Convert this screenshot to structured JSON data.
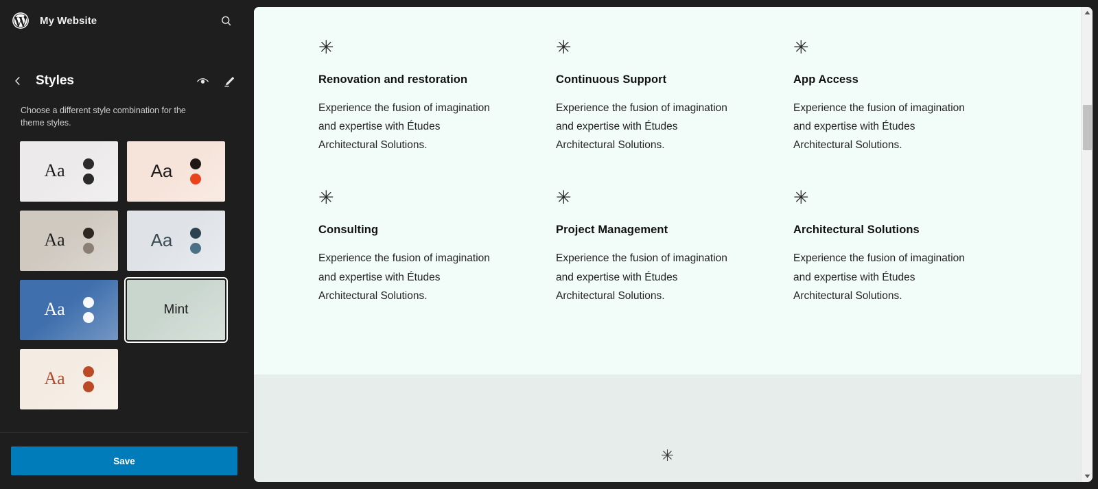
{
  "app": {
    "site_title": "My Website",
    "logo_icon": "wordpress-logo-icon",
    "search_icon": "search-icon"
  },
  "styles_panel": {
    "back_icon": "chevron-left-icon",
    "title": "Styles",
    "preview_icon": "eye-icon",
    "edit_icon": "pencil-icon",
    "description": "Choose a different style combination for the theme styles.",
    "save_label": "Save",
    "save_color": "#007cba",
    "variations": [
      {
        "name": "variation-1",
        "sample_text": "Aa",
        "font": "serif",
        "background": "#eceaea",
        "text_color": "#1d1d1d",
        "dot_1": "#2b2b2b",
        "dot_2": "#2b2b2b",
        "selected": false
      },
      {
        "name": "variation-2",
        "sample_text": "Aa",
        "font": "sans",
        "background": "#f6e3d9",
        "text_color": "#1d1d1d",
        "dot_1": "#211714",
        "dot_2": "#e8431a",
        "selected": false
      },
      {
        "name": "variation-3",
        "sample_text": "Aa",
        "font": "serif",
        "background": "#cfc9c0",
        "text_color": "#1d1d1d",
        "dot_1": "#2d2722",
        "dot_2": "#8b7f75",
        "selected": false
      },
      {
        "name": "variation-4",
        "sample_text": "Aa",
        "font": "sans",
        "background": "#dfe3e8",
        "text_color": "#3b4b54",
        "dot_1": "#2c4250",
        "dot_2": "#4a7186",
        "selected": false
      },
      {
        "name": "variation-5",
        "sample_text": "Aa",
        "font": "serif",
        "background": "#3f6fad",
        "text_color": "#ffffff",
        "dot_1": "#f7f9fc",
        "dot_2": "#f7f9fc",
        "selected": false
      },
      {
        "name": "variation-mint",
        "sample_text": "Mint",
        "font": "sans",
        "background": "#c9d6ce",
        "text_color": "#1d1d1d",
        "dot_1": null,
        "dot_2": null,
        "selected": true
      },
      {
        "name": "variation-7",
        "sample_text": "Aa",
        "font": "serif",
        "background": "#f4ece2",
        "text_color": "#b8492a",
        "dot_1": "#bb4a27",
        "dot_2": "#bb4a27",
        "selected": false
      }
    ]
  },
  "canvas": {
    "background": "#f2fcf8",
    "footer_background": "#e6edea",
    "asterisk_glyph": "✳",
    "footer_asterisk_glyph": "✳",
    "body_text": "Experience the fusion of imagination and expertise with Études Architectural Solutions.",
    "features": [
      {
        "title": "Renovation and restoration",
        "text": "Experience the fusion of imagination and expertise with Études Architectural Solutions."
      },
      {
        "title": "Continuous Support",
        "text": "Experience the fusion of imagination and expertise with Études Architectural Solutions."
      },
      {
        "title": "App Access",
        "text": "Experience the fusion of imagination and expertise with Études Architectural Solutions."
      },
      {
        "title": "Consulting",
        "text": "Experience the fusion of imagination and expertise with Études Architectural Solutions."
      },
      {
        "title": "Project Management",
        "text": "Experience the fusion of imagination and expertise with Études Architectural Solutions."
      },
      {
        "title": "Architectural Solutions",
        "text": "Experience the fusion of imagination and expertise with Études Architectural Solutions."
      }
    ]
  },
  "scrollbar": {
    "up_icon": "scroll-up-arrow-icon",
    "down_icon": "scroll-down-arrow-icon",
    "thumb": "scrollbar-thumb"
  }
}
